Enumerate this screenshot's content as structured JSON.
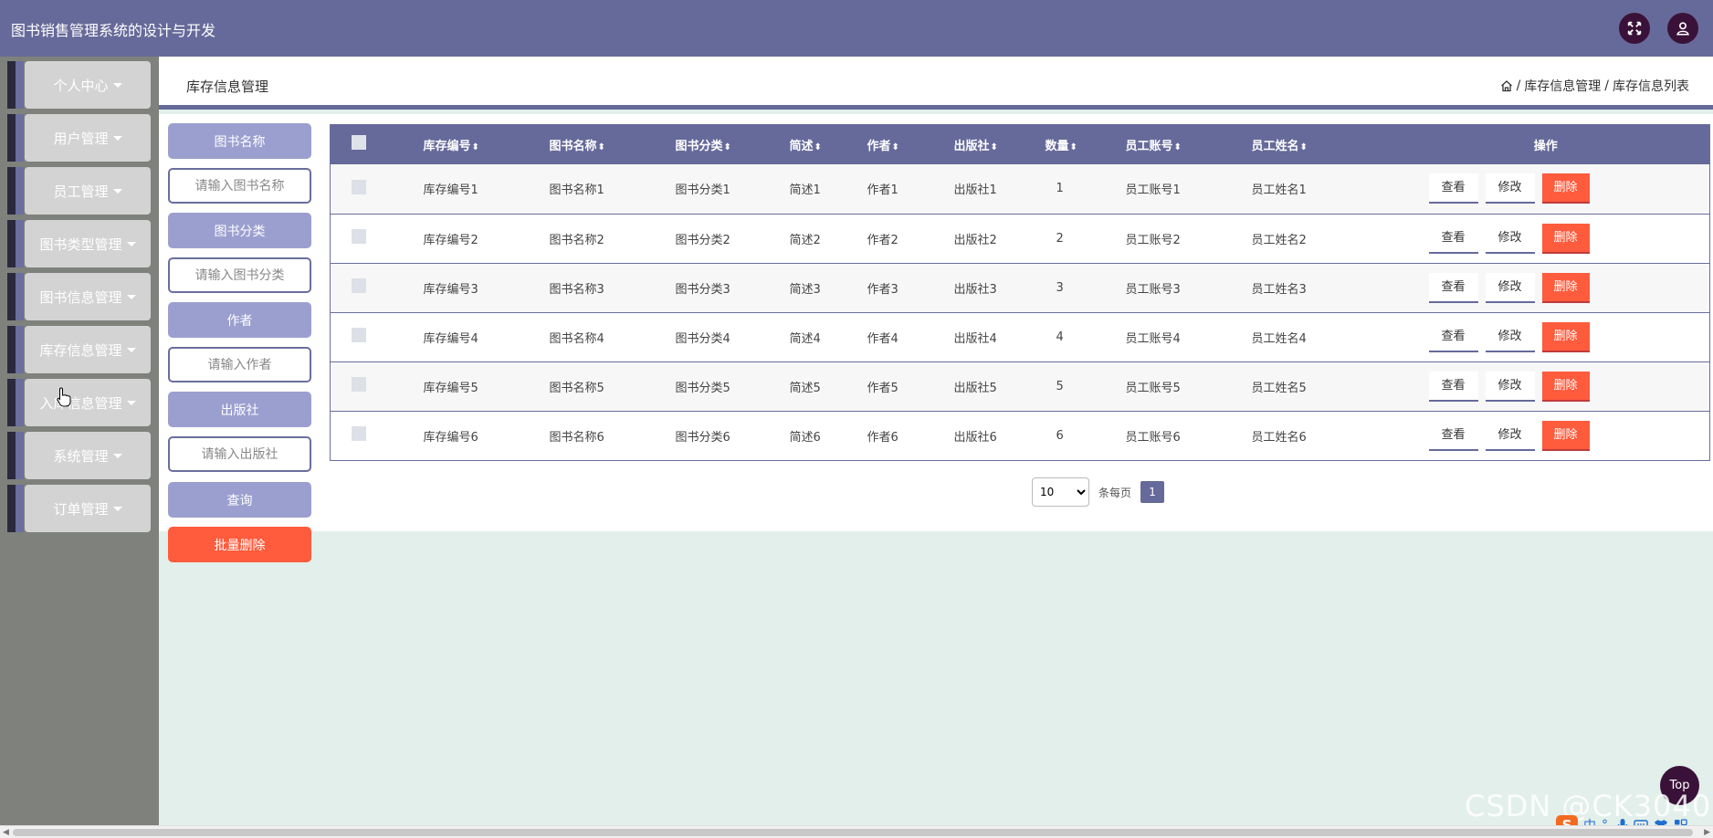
{
  "app": {
    "title": "图书销售管理系统的设计与开发"
  },
  "sidebar": {
    "items": [
      {
        "label": "个人中心"
      },
      {
        "label": "用户管理"
      },
      {
        "label": "员工管理"
      },
      {
        "label": "图书类型管理"
      },
      {
        "label": "图书信息管理"
      },
      {
        "label": "库存信息管理"
      },
      {
        "label": "入库信息管理"
      },
      {
        "label": "系统管理"
      },
      {
        "label": "订单管理"
      }
    ]
  },
  "header": {
    "page_title": "库存信息管理",
    "breadcrumb": [
      "库存信息管理",
      "库存信息列表"
    ],
    "breadcrumb_sep": "/"
  },
  "search": {
    "book_name_label": "图书名称",
    "book_name_placeholder": "请输入图书名称",
    "category_label": "图书分类",
    "category_placeholder": "请输入图书分类",
    "author_label": "作者",
    "author_placeholder": "请输入作者",
    "publisher_label": "出版社",
    "publisher_placeholder": "请输入出版社",
    "query_label": "查询",
    "bulk_delete_label": "批量删除"
  },
  "table": {
    "headers": [
      "库存编号",
      "图书名称",
      "图书分类",
      "简述",
      "作者",
      "出版社",
      "数量",
      "员工账号",
      "员工姓名",
      "操作"
    ],
    "sort_glyph": "⬍",
    "actions": {
      "view": "查看",
      "edit": "修改",
      "delete": "删除"
    },
    "rows": [
      [
        "库存编号1",
        "图书名称1",
        "图书分类1",
        "简述1",
        "作者1",
        "出版社1",
        "1",
        "员工账号1",
        "员工姓名1"
      ],
      [
        "库存编号2",
        "图书名称2",
        "图书分类2",
        "简述2",
        "作者2",
        "出版社2",
        "2",
        "员工账号2",
        "员工姓名2"
      ],
      [
        "库存编号3",
        "图书名称3",
        "图书分类3",
        "简述3",
        "作者3",
        "出版社3",
        "3",
        "员工账号3",
        "员工姓名3"
      ],
      [
        "库存编号4",
        "图书名称4",
        "图书分类4",
        "简述4",
        "作者4",
        "出版社4",
        "4",
        "员工账号4",
        "员工姓名4"
      ],
      [
        "库存编号5",
        "图书名称5",
        "图书分类5",
        "简述5",
        "作者5",
        "出版社5",
        "5",
        "员工账号5",
        "员工姓名5"
      ],
      [
        "库存编号6",
        "图书名称6",
        "图书分类6",
        "简述6",
        "作者6",
        "出版社6",
        "6",
        "员工账号6",
        "员工姓名6"
      ]
    ]
  },
  "pagination": {
    "page_size": "10",
    "per_page_label": "条每页",
    "current_page": "1"
  },
  "misc": {
    "top_label": "Top",
    "watermark": "CSDN @CK3040",
    "ime_label": "中"
  },
  "colors": {
    "primary": "#666a9a",
    "danger": "#ff5b3d",
    "accent_dark": "#3a1239"
  }
}
